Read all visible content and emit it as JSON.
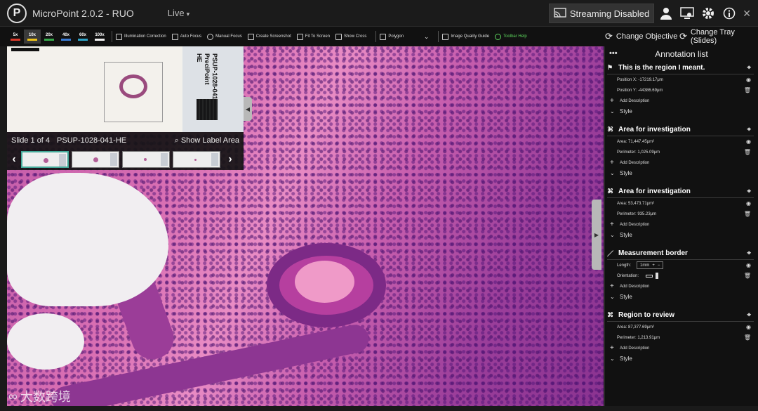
{
  "titlebar": {
    "logo_glyph": "P",
    "app_title": "MicroPoint 2.0.2 - RUO",
    "mode": "Live",
    "streaming": "Streaming Disabled"
  },
  "toolbar": {
    "magnifications": [
      {
        "label": "5x",
        "color": "#d93a2b"
      },
      {
        "label": "10x",
        "color": "#f0c419"
      },
      {
        "label": "20x",
        "color": "#35a84a"
      },
      {
        "label": "40x",
        "color": "#3a7bd5"
      },
      {
        "label": "60x",
        "color": "#2da3c7"
      },
      {
        "label": "100x",
        "color": "#f2f2f2"
      }
    ],
    "active_magnification": "10x",
    "tools": {
      "illumination": "Illumination Correction",
      "auto_focus": "Auto Focus",
      "manual_focus": "Manual Focus",
      "screenshot": "Create Screenshot",
      "fit": "Fit To Screen",
      "cross": "Show Cross",
      "shape": "Polygon",
      "quality": "Image Quality Guide",
      "help": "Toolbar Help"
    },
    "change_objective": "Change Objective",
    "change_tray": "Change Tray (Slides)"
  },
  "overview": {
    "label_lines": [
      "PSUP-1028-041",
      "PreciPoint",
      "HE"
    ],
    "slide_counter": "Slide 1 of 4",
    "slide_name": "PSUP-1028-041-HE",
    "show_label": "Show Label Area"
  },
  "watermark": {
    "glyph": "∞",
    "text": "大数跨境"
  },
  "panel": {
    "title": "Annotation list",
    "add_description": "Add Description",
    "style": "Style",
    "annotations": [
      {
        "type": "flag",
        "title": "This is the region I meant.",
        "rows": [
          {
            "label": "Position X:",
            "value": "-17219.17μm"
          },
          {
            "label": "Position Y:",
            "value": "-44386.69μm"
          }
        ]
      },
      {
        "type": "polygon",
        "title": "Area for investigation",
        "rows": [
          {
            "label": "Area:",
            "value": "71,447.45μm²"
          },
          {
            "label": "Perimeter:",
            "value": "1,025.09μm"
          }
        ]
      },
      {
        "type": "polygon",
        "title": "Area for investigation",
        "rows": [
          {
            "label": "Area:",
            "value": "53,473.71μm²"
          },
          {
            "label": "Perimeter:",
            "value": "935.23μm"
          }
        ]
      },
      {
        "type": "ruler",
        "title": "Measurement border",
        "length_label": "Length:",
        "length_value": "1mm",
        "orientation_label": "Orientation:"
      },
      {
        "type": "polygon",
        "title": "Region to review",
        "rows": [
          {
            "label": "Area:",
            "value": "87,377.69μm²"
          },
          {
            "label": "Perimeter:",
            "value": "1,213.91μm"
          }
        ]
      }
    ]
  }
}
